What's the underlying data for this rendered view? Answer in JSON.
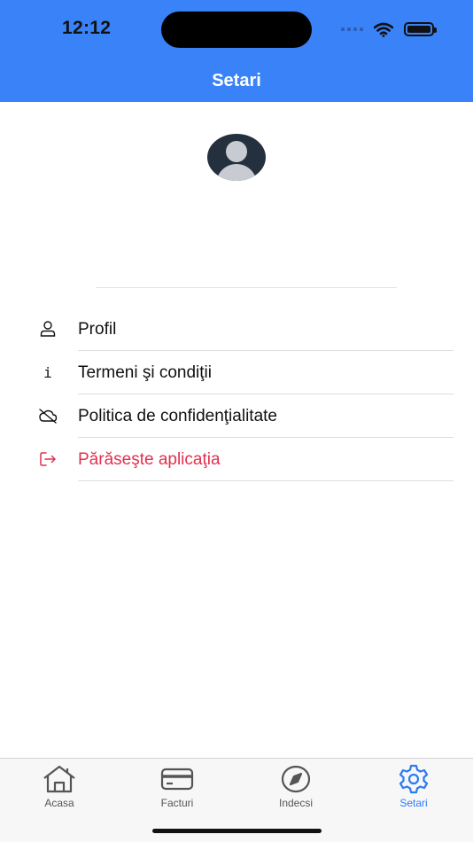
{
  "status_bar": {
    "time": "12:12"
  },
  "header": {
    "title": "Setari"
  },
  "menu": [
    {
      "icon": "person-icon",
      "label": "Profil"
    },
    {
      "icon": "info-icon",
      "label": "Termeni şi condiţii",
      "glyph": "i"
    },
    {
      "icon": "cloud-off-icon",
      "label": "Politica de confidenţialitate"
    },
    {
      "icon": "logout-icon",
      "label": "Părăseşte aplicaţia",
      "color": "#e0314f"
    }
  ],
  "tabs": [
    {
      "icon": "home-icon",
      "label": "Acasa"
    },
    {
      "icon": "card-icon",
      "label": "Facturi"
    },
    {
      "icon": "compass-icon",
      "label": "Indecsi"
    },
    {
      "icon": "gear-icon",
      "label": "Setari",
      "active": true
    }
  ],
  "colors": {
    "header": "#3a82f7",
    "accent": "#2d7cf2",
    "danger": "#e0314f"
  }
}
